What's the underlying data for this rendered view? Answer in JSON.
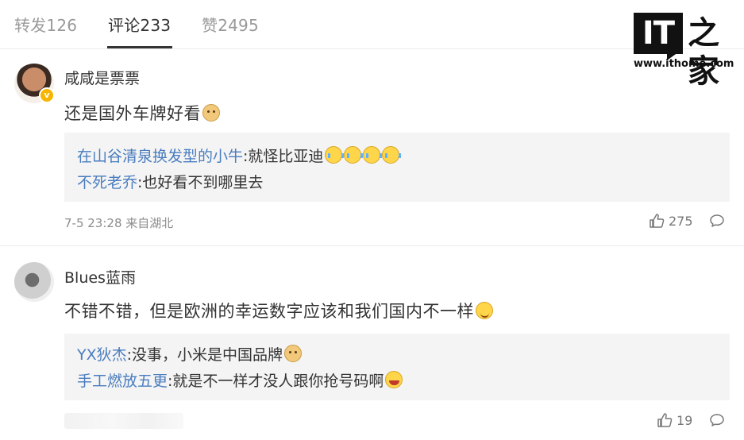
{
  "tabs": [
    {
      "label": "转发126"
    },
    {
      "label": "评论233"
    },
    {
      "label": "赞2495"
    }
  ],
  "logo": {
    "mark": "IT",
    "cn": "之家",
    "url": "www.ithome.com"
  },
  "comments": [
    {
      "username": "咸咸是票票",
      "content": "还是国外车牌好看",
      "verified_badge": "v",
      "replies": [
        {
          "user": "在山谷清泉换发型的小牛",
          "text": ":就怪比亚迪"
        },
        {
          "user": "不死老乔",
          "text": ":也好看不到哪里去"
        }
      ],
      "meta": "7-5 23:28 来自湖北",
      "likes": "275"
    },
    {
      "username": "Blues蓝雨",
      "content": "不错不错，但是欧洲的幸运数字应该和我们国内不一样",
      "replies": [
        {
          "user": "YX狄杰",
          "text": ":没事，小米是中国品牌"
        },
        {
          "user": "手工燃放五更",
          "text": ":就是不一样才没人跟你抢号码啊"
        }
      ],
      "meta": "",
      "likes": "19"
    }
  ],
  "icons": {
    "like": "thumbs-up-icon",
    "comment": "comment-bubble-icon"
  },
  "colors": {
    "reply_user": "#4a7dbf",
    "reply_bg": "#f4f4f4",
    "verified": "#f7b500"
  }
}
